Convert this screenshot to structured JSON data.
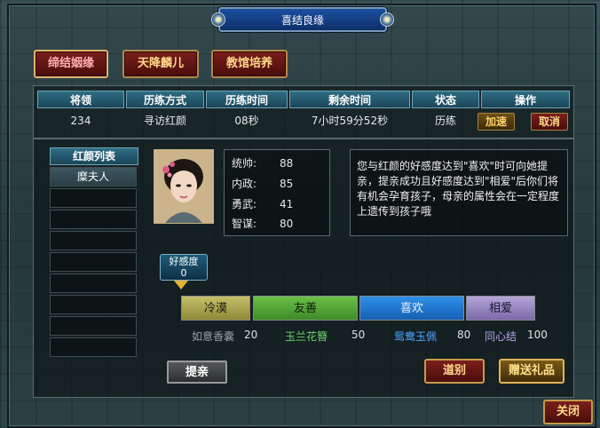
{
  "window": {
    "title": "喜结良缘"
  },
  "tabs": [
    {
      "label": "缔结姻缘",
      "active": true
    },
    {
      "label": "天降麟儿",
      "active": false
    },
    {
      "label": "教馆培养",
      "active": false
    }
  ],
  "training_table": {
    "headers": [
      "将领",
      "历练方式",
      "历练时间",
      "剩余时间",
      "状态",
      "操作"
    ],
    "row": {
      "general": "234",
      "method": "寻访红颜",
      "train_time": "08秒",
      "remaining": "7小时59分52秒",
      "status": "历练",
      "speed_label": "加速",
      "cancel_label": "取消"
    }
  },
  "beauty_list": {
    "header": "红颜列表",
    "items": [
      "糜夫人"
    ]
  },
  "character": {
    "stats": [
      {
        "label": "统帅:",
        "value": "88"
      },
      {
        "label": "内政:",
        "value": "85"
      },
      {
        "label": "勇武:",
        "value": "41"
      },
      {
        "label": "智谋:",
        "value": "80"
      }
    ],
    "description": "您与红颜的好感度达到\"喜欢\"时可向她提亲，提亲成功且好感度达到\"相爱\"后你们将有机会孕育孩子，母亲的属性会在一定程度上遗传到孩子哦"
  },
  "favor": {
    "label": "好感度",
    "value": "0",
    "stages": [
      {
        "name": "冷漠",
        "color": "#b6b05e"
      },
      {
        "name": "友善",
        "color": "#5aaa3a"
      },
      {
        "name": "喜欢",
        "color": "#1f7ed8"
      },
      {
        "name": "相爱",
        "color": "#9c8cc4"
      }
    ],
    "thresholds": [
      {
        "item": "如意香囊",
        "value": "20",
        "color": "#9aa0a6"
      },
      {
        "item": "玉兰花簪",
        "value": "50",
        "color": "#6cd46c"
      },
      {
        "item": "鸳鸯玉佩",
        "value": "80",
        "color": "#4ea6ff"
      },
      {
        "item": "同心结",
        "value": "100",
        "color": "#b7a3ea"
      }
    ]
  },
  "actions": {
    "propose": "提亲",
    "farewell": "道别",
    "gift": "赠送礼品",
    "close": "关闭"
  }
}
